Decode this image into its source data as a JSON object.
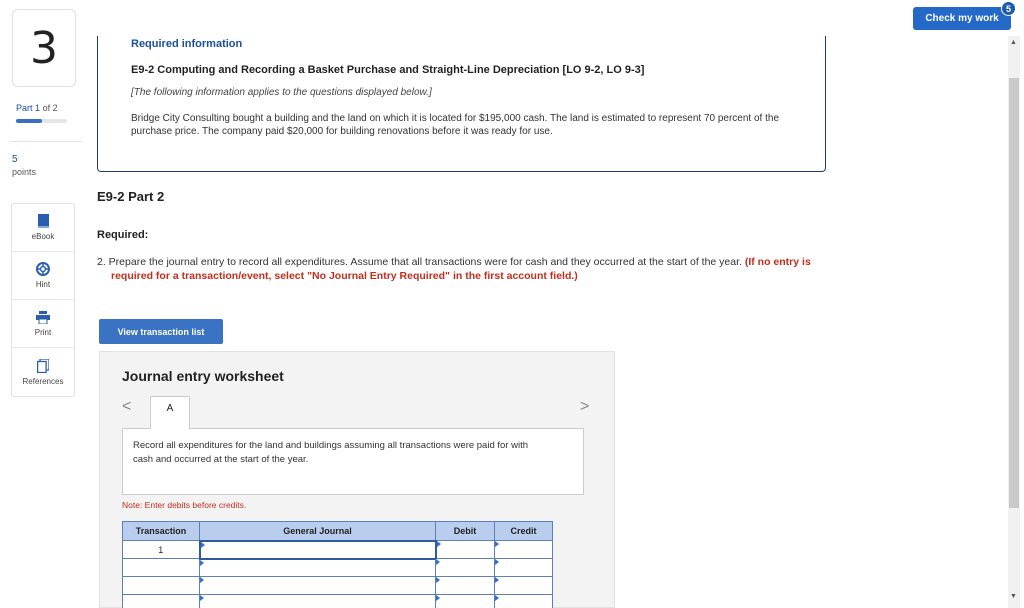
{
  "rail": {
    "question_number": "3",
    "part_label": "Part",
    "part_num": "1",
    "part_of": "of 2",
    "part_progress": 0.5,
    "points_value": "5",
    "points_label": "points",
    "tools": [
      {
        "label": "eBook",
        "icon": "book-icon"
      },
      {
        "label": "Hint",
        "icon": "lifebuoy-icon"
      },
      {
        "label": "Print",
        "icon": "printer-icon"
      },
      {
        "label": "References",
        "icon": "document-icon"
      }
    ]
  },
  "header": {
    "check_button": "Check my work",
    "badge_count": "5"
  },
  "info": {
    "heading": "Required information",
    "title": "E9-2 Computing and Recording a Basket Purchase and Straight-Line Depreciation [LO 9-2, LO 9-3]",
    "note": "[The following information applies to the questions displayed below.]",
    "paragraph": "Bridge City Consulting bought a building and the land on which it is located for $195,000 cash. The land is estimated to represent 70 percent of the purchase price. The company paid $20,000 for building renovations before it was ready for use."
  },
  "part_heading": "E9-2 Part 2",
  "required_label": "Required:",
  "instruction": {
    "text": "2. Prepare the journal entry to record all expenditures. Assume that all transactions were for cash and they occurred at the start of the year.",
    "red": "(If no entry is required for a transaction/event, select \"No Journal Entry Required\" in the first account field.)"
  },
  "view_transaction_button": "View transaction list",
  "worksheet": {
    "title": "Journal entry worksheet",
    "tab_label": "A",
    "nav_prev": "<",
    "nav_next": ">",
    "panel_text": "Record all expenditures for the land and buildings assuming all transactions were paid for with cash and occurred at the start of the year.",
    "note": "Note: Enter debits before credits.",
    "columns": [
      "Transaction",
      "General Journal",
      "Debit",
      "Credit"
    ],
    "rows": [
      {
        "transaction": "1"
      },
      {
        "transaction": ""
      },
      {
        "transaction": ""
      },
      {
        "transaction": ""
      }
    ]
  }
}
